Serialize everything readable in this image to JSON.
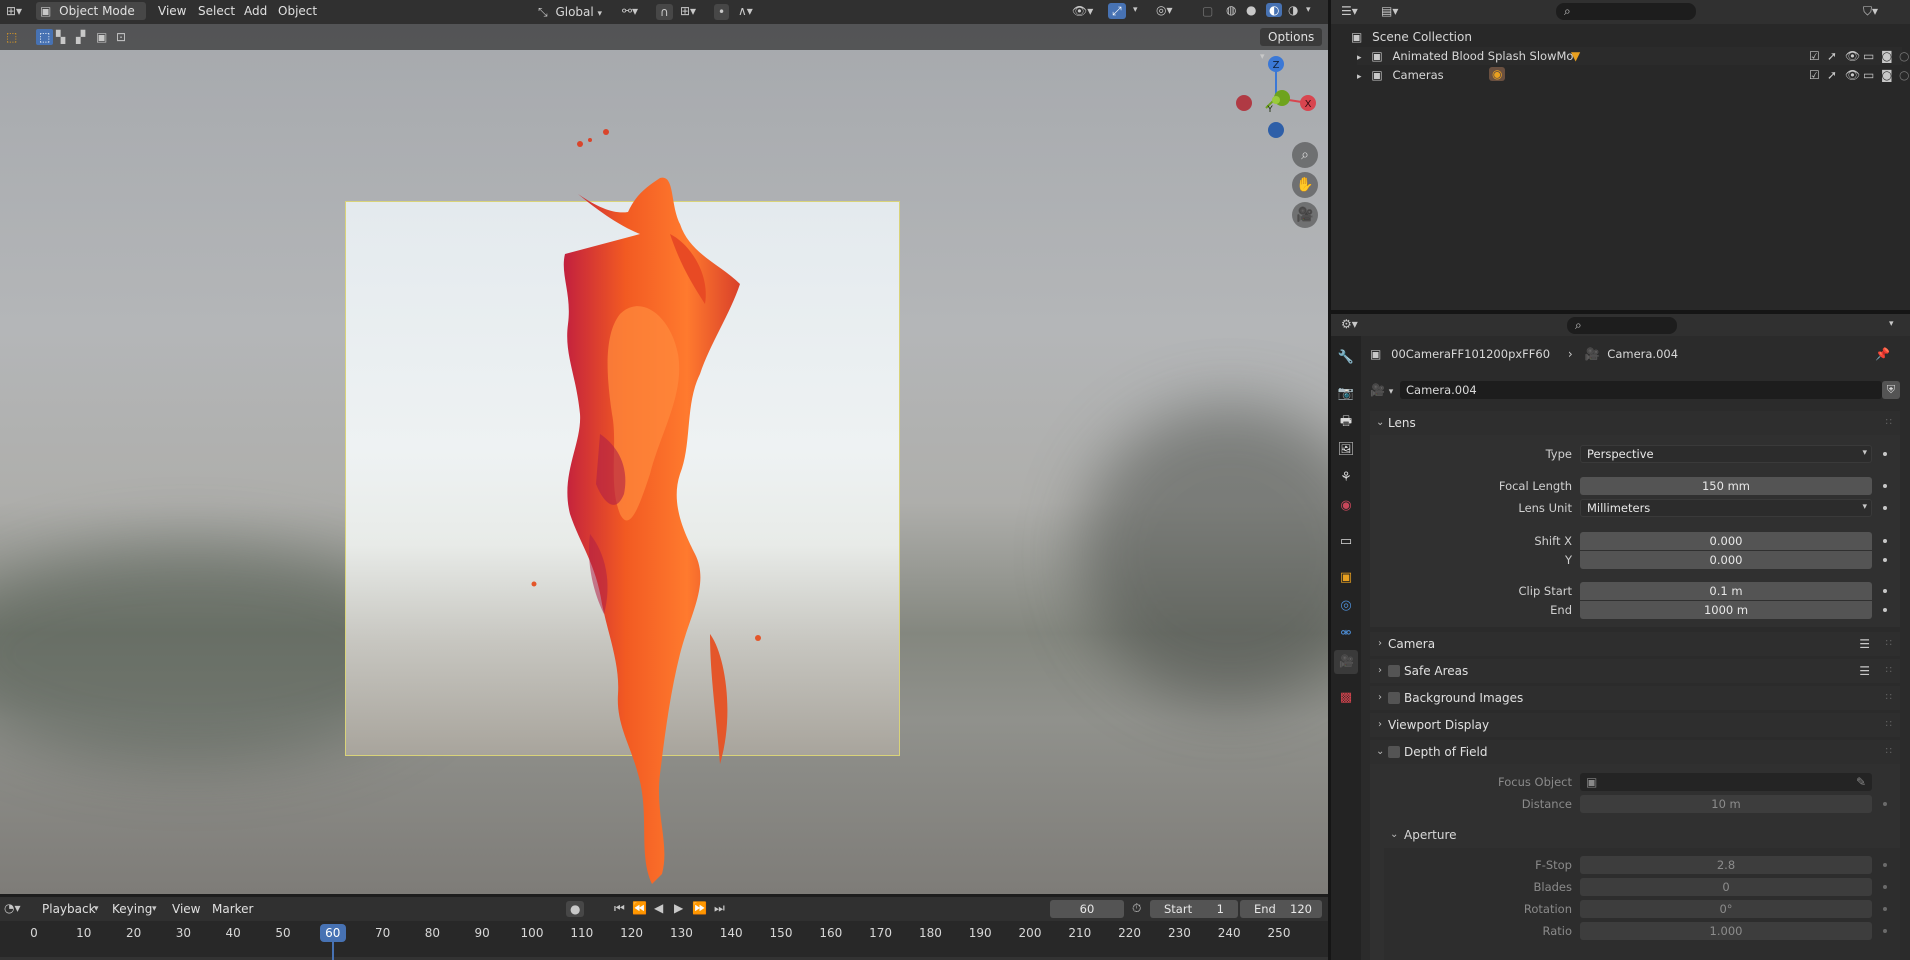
{
  "viewport": {
    "mode": "Object Mode",
    "menus": [
      "View",
      "Select",
      "Add",
      "Object"
    ],
    "transform_orientation": "Global",
    "options_label": "Options",
    "gizmo": {
      "z": "Z",
      "x": "X",
      "y": "Y"
    }
  },
  "outliner": {
    "root": "Scene Collection",
    "items": [
      {
        "label": "Animated Blood Splash SlowMo"
      },
      {
        "label": "Cameras"
      }
    ]
  },
  "properties": {
    "breadcrumb_object": "00CameraFF101200pxFF60",
    "breadcrumb_data": "Camera.004",
    "datablock_name": "Camera.004",
    "lens": {
      "header": "Lens",
      "type_label": "Type",
      "type_value": "Perspective",
      "focal_label": "Focal Length",
      "focal_value": "150 mm",
      "lens_unit_label": "Lens Unit",
      "lens_unit_value": "Millimeters",
      "shift_x_label": "Shift X",
      "shift_x_value": "0.000",
      "shift_y_label": "Y",
      "shift_y_value": "0.000",
      "clip_start_label": "Clip Start",
      "clip_start_value": "0.1 m",
      "clip_end_label": "End",
      "clip_end_value": "1000 m"
    },
    "panels": {
      "camera": "Camera",
      "safe_areas": "Safe Areas",
      "background_images": "Background Images",
      "viewport_display": "Viewport Display",
      "dof": "Depth of Field"
    },
    "dof": {
      "focus_object_label": "Focus Object",
      "distance_label": "Distance",
      "distance_value": "10 m",
      "aperture_header": "Aperture",
      "fstop_label": "F-Stop",
      "fstop_value": "2.8",
      "blades_label": "Blades",
      "blades_value": "0",
      "rotation_label": "Rotation",
      "rotation_value": "0°",
      "ratio_label": "Ratio",
      "ratio_value": "1.000"
    }
  },
  "timeline": {
    "menus": [
      "Playback",
      "Keying",
      "View",
      "Marker"
    ],
    "current_frame": "60",
    "start_label": "Start",
    "start_value": "1",
    "end_label": "End",
    "end_value": "120",
    "ticks": [
      "0",
      "10",
      "20",
      "30",
      "40",
      "50",
      "60",
      "70",
      "80",
      "90",
      "100",
      "110",
      "120",
      "130",
      "140",
      "150",
      "160",
      "170",
      "180",
      "190",
      "200",
      "210",
      "220",
      "230",
      "240",
      "250"
    ],
    "playhead_frame": 60
  },
  "colors": {
    "accent": "#4772b3",
    "camera_frame": "#d9d37a",
    "splash": "#f0521e",
    "active_tab": "#3fb37f"
  }
}
